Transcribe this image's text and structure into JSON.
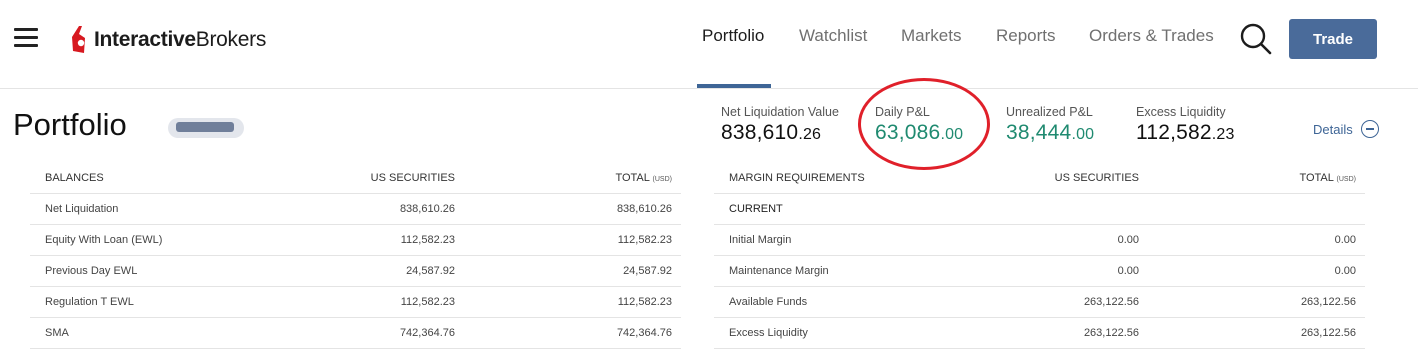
{
  "header": {
    "logo": {
      "bold": "Interactive",
      "regular": "Brokers"
    },
    "nav": [
      "Portfolio",
      "Watchlist",
      "Markets",
      "Reports",
      "Orders & Trades"
    ],
    "active_nav": "Portfolio",
    "trade_label": "Trade",
    "accent": "#4a6b9a"
  },
  "page": {
    "title": "Portfolio"
  },
  "summary": {
    "net_liq": {
      "label": "Net Liquidation Value",
      "whole": "838,610",
      "cents": ".26"
    },
    "daily_pnl": {
      "label": "Daily P&L",
      "whole": "63,086",
      "cents": ".00"
    },
    "unrealized_pnl": {
      "label": "Unrealized P&L",
      "whole": "38,444",
      "cents": ".00"
    },
    "excess_liq": {
      "label": "Excess Liquidity",
      "whole": "112,582",
      "cents": ".23"
    },
    "details_label": "Details",
    "positive_color": "#1f8a70",
    "highlight_color": "#e0202a"
  },
  "balances": {
    "headers": {
      "name": "BALANCES",
      "us": "US SECURITIES",
      "total": "TOTAL",
      "unit": "(USD)"
    },
    "rows": [
      {
        "label": "Net Liquidation",
        "us": "838,610.26",
        "total": "838,610.26"
      },
      {
        "label": "Equity With Loan (EWL)",
        "us": "112,582.23",
        "total": "112,582.23"
      },
      {
        "label": "Previous Day EWL",
        "us": "24,587.92",
        "total": "24,587.92"
      },
      {
        "label": "Regulation T EWL",
        "us": "112,582.23",
        "total": "112,582.23"
      },
      {
        "label": "SMA",
        "us": "742,364.76",
        "total": "742,364.76"
      }
    ]
  },
  "margin": {
    "headers": {
      "name": "MARGIN REQUIREMENTS",
      "us": "US SECURITIES",
      "total": "TOTAL",
      "unit": "(USD)"
    },
    "section": "CURRENT",
    "rows": [
      {
        "label": "Initial Margin",
        "us": "0.00",
        "total": "0.00"
      },
      {
        "label": "Maintenance Margin",
        "us": "0.00",
        "total": "0.00"
      },
      {
        "label": "Available Funds",
        "us": "263,122.56",
        "total": "263,122.56"
      },
      {
        "label": "Excess Liquidity",
        "us": "263,122.56",
        "total": "263,122.56"
      }
    ]
  }
}
